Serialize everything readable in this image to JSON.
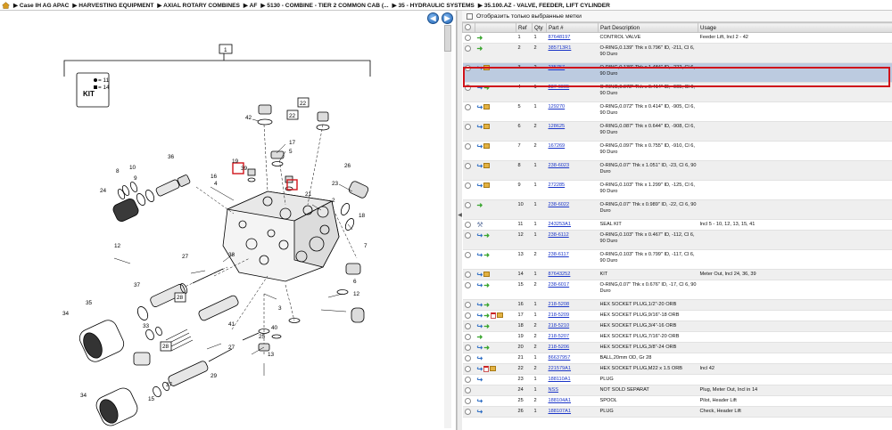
{
  "breadcrumb": {
    "home_icon": "home-icon",
    "items": [
      "▶ Case IH AG APAC",
      "▶ HARVESTING EQUIPMENT",
      "▶ AXIAL ROTARY COMBINES",
      "▶ AF",
      "▶ 5130 - COMBINE - TIER 2 COMMON CAB (...",
      "▶ 35 - HYDRAULIC SYSTEMS",
      "▶ 35.100.AZ - VALVE, FEEDER, LIFT CYLINDER"
    ]
  },
  "nav": {
    "prev_icon": "left-arrow-icon",
    "next_icon": "right-arrow-icon",
    "prev_glyph": "◀",
    "next_glyph": "▶"
  },
  "diagram": {
    "kit_legend": [
      "= 11",
      "= 14"
    ],
    "kit_label": "KIT",
    "callouts": [
      "1",
      "42",
      "22",
      "17",
      "5",
      "4",
      "19",
      "39",
      "16",
      "36",
      "10",
      "8",
      "9",
      "24",
      "26",
      "23",
      "21",
      "2",
      "18",
      "27",
      "38",
      "7",
      "37",
      "6",
      "12",
      "35",
      "28",
      "34",
      "33",
      "29",
      "41",
      "40",
      "25",
      "13",
      "3",
      "15"
    ]
  },
  "filter": {
    "label": "Отобразить только выбранные метки",
    "checked": false
  },
  "table": {
    "headers": [
      "",
      "",
      "Ref",
      "Qty",
      "Part #",
      "Part Description",
      "Usage"
    ],
    "rows": [
      {
        "icons": [
          "dot",
          "arrow"
        ],
        "ref": "1",
        "qty": "1",
        "part": "87648197",
        "desc": "CONTROL VALVE",
        "usage": "Feeder Lift, Incl 2 - 42",
        "h": "short"
      },
      {
        "icons": [
          "dot",
          "arrow"
        ],
        "ref": "2",
        "qty": "2",
        "part": "385713R1",
        "desc": "O-RING,0.139\" Thk x 0.796\" ID, -211, Cl 6, 90 Duro",
        "usage": "",
        "h": "tall"
      },
      {
        "icons": [
          "dot",
          "blue",
          "box"
        ],
        "ref": "3",
        "qty": "2",
        "part": "235757",
        "desc": "O-RING,0.139\" Thk x 1.484\" ID, -222, Cl 6, 90 Duro",
        "usage": "",
        "h": "tall",
        "selected": true
      },
      {
        "icons": [
          "dot",
          "blue",
          "arrow"
        ],
        "ref": "4",
        "qty": "1",
        "part": "237-6005",
        "desc": "O-RING,0.072\" Thk x 0.414\" ID, -905, Cl 6, 90 Duro",
        "usage": "",
        "h": "tall"
      },
      {
        "icons": [
          "dot",
          "blue",
          "box"
        ],
        "ref": "5",
        "qty": "1",
        "part": "129270",
        "desc": "O-RING,0.072\" Thk x 0.414\" ID, -905, Cl 6, 90 Duro",
        "usage": "",
        "h": "tall"
      },
      {
        "icons": [
          "dot",
          "blue",
          "box"
        ],
        "ref": "6",
        "qty": "2",
        "part": "128625",
        "desc": "O-RING,0.087\" Thk x 0.644\" ID, -908, Cl 6, 90 Duro",
        "usage": "",
        "h": "tall"
      },
      {
        "icons": [
          "dot",
          "blue",
          "box"
        ],
        "ref": "7",
        "qty": "2",
        "part": "167269",
        "desc": "O-RING,0.097\" Thk x 0.755\" ID, -910, Cl 6, 90 Duro",
        "usage": "",
        "h": "tall"
      },
      {
        "icons": [
          "dot",
          "blue",
          "box"
        ],
        "ref": "8",
        "qty": "1",
        "part": "238-6023",
        "desc": "O-RING,0.07\" Thk x 1.051\" ID, -23, Cl 6, 90 Duro",
        "usage": "",
        "h": "tall"
      },
      {
        "icons": [
          "dot",
          "blue",
          "box"
        ],
        "ref": "9",
        "qty": "1",
        "part": "272285",
        "desc": "O-RING,0.103\" Thk x 1.299\" ID, -125, Cl 6, 90 Duro",
        "usage": "",
        "h": "tall"
      },
      {
        "icons": [
          "dot",
          "arrow"
        ],
        "ref": "10",
        "qty": "1",
        "part": "238-6022",
        "desc": "O-RING,0.07\" Thk x 0.989\" ID, -22, Cl 6, 90 Duro",
        "usage": "",
        "h": "tall"
      },
      {
        "icons": [
          "dot",
          "wrench"
        ],
        "ref": "11",
        "qty": "1",
        "part": "243253A1",
        "desc": "SEAL KIT",
        "usage": "Incl 5 - 10, 12, 13, 15, 41",
        "h": "short"
      },
      {
        "icons": [
          "dot",
          "blue",
          "arrow"
        ],
        "ref": "12",
        "qty": "1",
        "part": "238-6112",
        "desc": "O-RING,0.103\" Thk x 0.467\" ID, -112, Cl 6, 90 Duro",
        "usage": "",
        "h": "tall"
      },
      {
        "icons": [
          "dot",
          "blue",
          "arrow"
        ],
        "ref": "13",
        "qty": "2",
        "part": "238-6117",
        "desc": "O-RING,0.103\" Thk x 0.799\" ID, -117, Cl 6, 90 Duro",
        "usage": "",
        "h": "tall"
      },
      {
        "icons": [
          "dot",
          "blue",
          "box"
        ],
        "ref": "14",
        "qty": "1",
        "part": "87643252",
        "desc": "KIT",
        "usage": "Meter Out, Incl 24, 36, 39",
        "h": "short"
      },
      {
        "icons": [
          "dot",
          "blue",
          "arrow"
        ],
        "ref": "15",
        "qty": "2",
        "part": "238-6017",
        "desc": "O-RING,0.07\" Thk x 0.676\" ID, -17, Cl 6, 90 Duro",
        "usage": "",
        "h": "tall"
      },
      {
        "icons": [
          "dot",
          "blue",
          "arrow"
        ],
        "ref": "16",
        "qty": "1",
        "part": "218-5208",
        "desc": "HEX SOCKET PLUG,1/2\"-20 ORB",
        "usage": "",
        "h": "short"
      },
      {
        "icons": [
          "dot",
          "blue",
          "arrow",
          "doc",
          "box"
        ],
        "ref": "17",
        "qty": "1",
        "part": "218-5209",
        "desc": "HEX SOCKET PLUG,9/16\"-18 ORB",
        "usage": "",
        "h": "short"
      },
      {
        "icons": [
          "dot",
          "blue",
          "arrow"
        ],
        "ref": "18",
        "qty": "2",
        "part": "218-5210",
        "desc": "HEX SOCKET PLUG,3/4\"-16 ORB",
        "usage": "",
        "h": "short"
      },
      {
        "icons": [
          "dot",
          "arrow"
        ],
        "ref": "19",
        "qty": "2",
        "part": "218-5207",
        "desc": "HEX SOCKET PLUG,7/16\"-20 ORB",
        "usage": "",
        "h": "short"
      },
      {
        "icons": [
          "dot",
          "blue",
          "arrow"
        ],
        "ref": "20",
        "qty": "2",
        "part": "218-5206",
        "desc": "HEX SOCKET PLUG,3/8\"-24 ORB",
        "usage": "",
        "h": "short"
      },
      {
        "icons": [
          "dot",
          "blue"
        ],
        "ref": "21",
        "qty": "1",
        "part": "86637957",
        "desc": "BALL,20mm OD, Gr 28",
        "usage": "",
        "h": "short"
      },
      {
        "icons": [
          "dot",
          "blue",
          "doc",
          "box"
        ],
        "ref": "22",
        "qty": "2",
        "part": "221579A1",
        "desc": "HEX SOCKET PLUG,M22 x 1.5 ORB",
        "usage": "Incl 42",
        "h": "short"
      },
      {
        "icons": [
          "dot",
          "blue"
        ],
        "ref": "23",
        "qty": "1",
        "part": "188110A1",
        "desc": "PLUG",
        "usage": "",
        "h": "short"
      },
      {
        "icons": [
          "dot"
        ],
        "ref": "24",
        "qty": "1",
        "part": "NSS",
        "desc": "NOT SOLD SEPARAT",
        "usage": "Plug, Meter Out, Incl in 14",
        "h": "short"
      },
      {
        "icons": [
          "dot",
          "blue"
        ],
        "ref": "25",
        "qty": "2",
        "part": "188104A1",
        "desc": "SPOOL",
        "usage": "Pilot, Header Lift",
        "h": "short"
      },
      {
        "icons": [
          "dot",
          "blue"
        ],
        "ref": "26",
        "qty": "1",
        "part": "188107A1",
        "desc": "PLUG",
        "usage": "Check, Header Lift",
        "h": "short"
      }
    ]
  },
  "colors": {
    "selection": "#bccbe0",
    "highlight_border": "#d0141b",
    "link": "#1a35c8"
  }
}
